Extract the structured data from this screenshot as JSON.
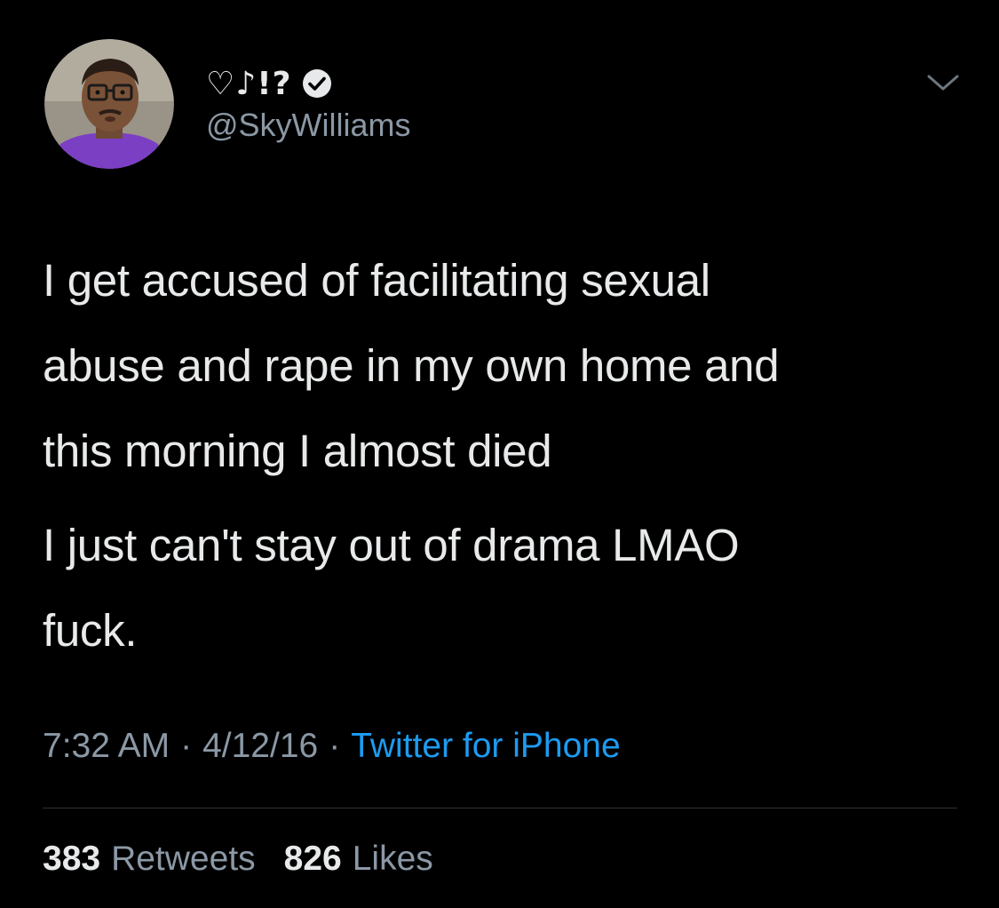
{
  "user": {
    "display_name": "♡♪!?",
    "handle": "@SkyWilliams",
    "verified": true,
    "avatar_icon": "profile-photo"
  },
  "tweet": {
    "paragraphs": [
      "I get accused of facilitating sexual\nabuse and rape in my own home and\nthis morning I almost died",
      "I just can't stay out of drama LMAO\nfuck."
    ],
    "time": "7:32 AM",
    "date": "4/12/16",
    "separator": "·",
    "source": "Twitter for iPhone"
  },
  "stats": {
    "retweets_count": "383",
    "retweets_label": "Retweets",
    "likes_count": "826",
    "likes_label": "Likes"
  },
  "colors": {
    "background": "#000000",
    "text_primary": "#e7e9ea",
    "text_secondary": "#8b98a5",
    "link": "#1d9bf0",
    "divider": "#2f3336"
  },
  "icons": {
    "verified": "verified-badge-icon",
    "menu": "chevron-down-icon"
  }
}
